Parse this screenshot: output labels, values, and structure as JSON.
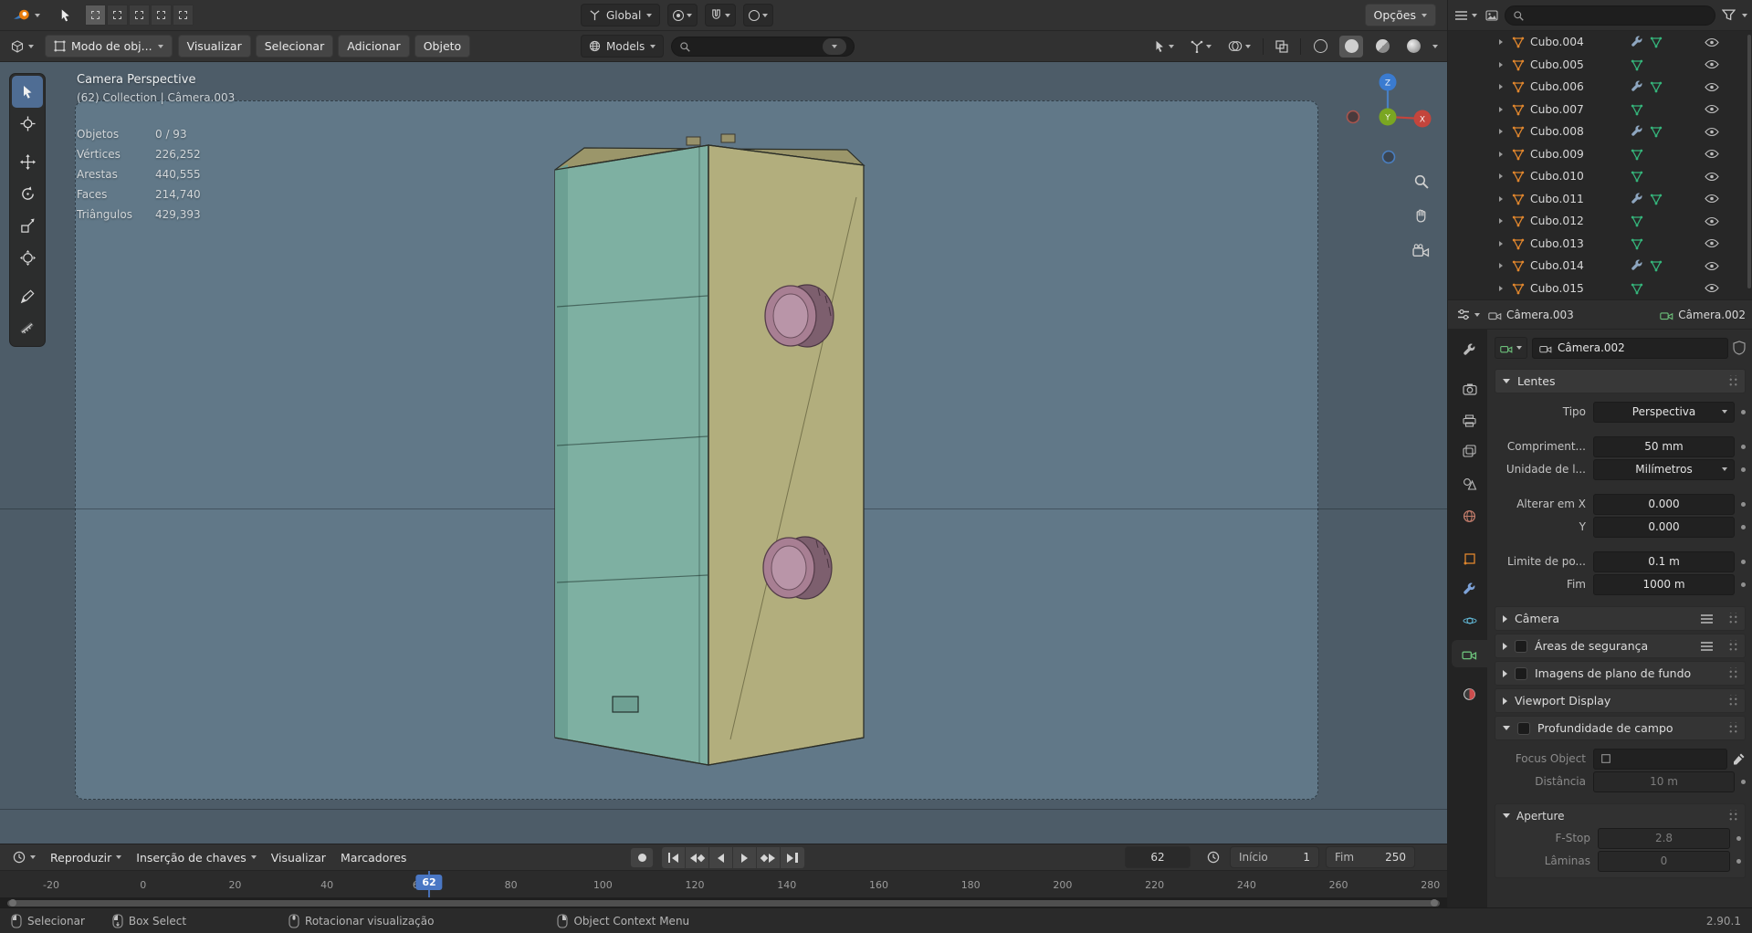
{
  "topbar": {
    "orientation_label": "Global",
    "options_label": "Opções"
  },
  "viewport_header": {
    "mode_label": "Modo de obj...",
    "menus": [
      "Visualizar",
      "Selecionar",
      "Adicionar",
      "Objeto"
    ],
    "models_label": "Models"
  },
  "viewport": {
    "view_label": "Camera Perspective",
    "context_label": "(62) Collection | Câmera.003",
    "stats": [
      {
        "label": "Objetos",
        "value": "0 / 93"
      },
      {
        "label": "Vértices",
        "value": "226,252"
      },
      {
        "label": "Arestas",
        "value": "440,555"
      },
      {
        "label": "Faces",
        "value": "214,740"
      },
      {
        "label": "Triângulos",
        "value": "429,393"
      }
    ]
  },
  "outliner": {
    "items": [
      {
        "name": "Cubo.004",
        "modifier": true
      },
      {
        "name": "Cubo.005",
        "modifier": false
      },
      {
        "name": "Cubo.006",
        "modifier": true
      },
      {
        "name": "Cubo.007",
        "modifier": false
      },
      {
        "name": "Cubo.008",
        "modifier": true
      },
      {
        "name": "Cubo.009",
        "modifier": false
      },
      {
        "name": "Cubo.010",
        "modifier": false
      },
      {
        "name": "Cubo.011",
        "modifier": true
      },
      {
        "name": "Cubo.012",
        "modifier": false
      },
      {
        "name": "Cubo.013",
        "modifier": false
      },
      {
        "name": "Cubo.014",
        "modifier": true
      },
      {
        "name": "Cubo.015",
        "modifier": false
      }
    ]
  },
  "properties": {
    "breadcrumb_object": "Câmera.003",
    "breadcrumb_data": "Câmera.002",
    "name_value": "Câmera.002",
    "lens_title": "Lentes",
    "lens_rows": [
      {
        "label": "Tipo",
        "value": "Perspectiva",
        "dropdown": true
      },
      {
        "label": "Compriment...",
        "value": "50 mm",
        "dropdown": false
      },
      {
        "label": "Unidade de l...",
        "value": "Milímetros",
        "dropdown": true
      },
      {
        "label": "Alterar em X",
        "value": "0.000",
        "dropdown": false
      },
      {
        "label": "Y",
        "value": "0.000",
        "dropdown": false
      },
      {
        "label": "Limite de po...",
        "value": "0.1 m",
        "dropdown": false
      },
      {
        "label": "Fim",
        "value": "1000 m",
        "dropdown": false
      }
    ],
    "section_camera": "Câmera",
    "section_safe_areas": "Áreas de segurança",
    "section_background": "Imagens de plano de fundo",
    "section_viewport_display": "Viewport Display",
    "section_dof": "Profundidade de campo",
    "dof": {
      "focus_label": "Focus Object",
      "distance_label": "Distância",
      "distance_value": "10 m",
      "aperture_title": "Aperture",
      "fstop_label": "F-Stop",
      "fstop_value": "2.8",
      "blades_label": "Lâminas",
      "blades_value": "0"
    }
  },
  "timeline": {
    "menu_play": "Reproduzir",
    "menu_keying": "Inserção de chaves",
    "menu_view": "Visualizar",
    "menu_markers": "Marcadores",
    "current_frame": "62",
    "playhead_label": "62",
    "start_label": "Início",
    "start_value": "1",
    "end_label": "Fim",
    "end_value": "250",
    "ticks": [
      "-20",
      "0",
      "20",
      "40",
      "60",
      "80",
      "100",
      "120",
      "140",
      "160",
      "180",
      "200",
      "220",
      "240",
      "260",
      "280"
    ]
  },
  "statusbar": {
    "select_label": "Selecionar",
    "box_select_label": "Box Select",
    "rotate_label": "Rotacionar visualização",
    "context_menu_label": "Object Context Menu",
    "version": "2.90.1"
  },
  "colors": {
    "accent_blue": "#4a77c4",
    "object_orange": "#e0862d",
    "mesh_green": "#35b57b",
    "axis_x_red": "#c4453c",
    "axis_y_green": "#7aa622",
    "axis_z_blue": "#3a7bd0"
  }
}
